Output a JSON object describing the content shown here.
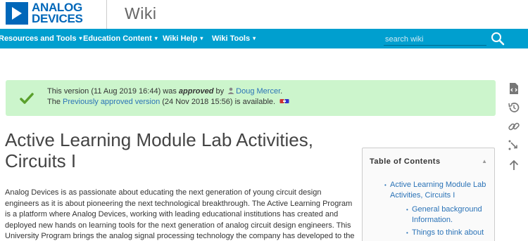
{
  "header": {
    "logo_line1": "ANALOG",
    "logo_line2": "DEVICES",
    "site_title": "Wiki"
  },
  "nav": {
    "items": [
      {
        "label": "Resources and Tools"
      },
      {
        "label": "Education Content"
      },
      {
        "label": "Wiki Help"
      },
      {
        "label": "Wiki Tools"
      }
    ],
    "search_placeholder": "search wiki"
  },
  "notice": {
    "line1_prefix": "This version (11 Aug 2019 16:44) was ",
    "line1_status": "approved",
    "line1_by": " by ",
    "line1_user": "Doug Mercer",
    "line1_end": ".",
    "line2_prefix": "The ",
    "line2_link": "Previously approved version",
    "line2_suffix": " (24 Nov 2018 15:56) is available."
  },
  "page": {
    "title": "Active Learning Module Lab Activities, Circuits I",
    "intro": "Analog Devices is as passionate about educating the next generation of young circuit design engineers as it is about pioneering the next technological breakthrough. The Active Learning Program is a platform where Analog Devices, working with leading educational institutions has created and deployed new hands on learning tools for the next generation of analog circuit design engineers. This University Program brings the analog signal processing technology the company has developed to the academic community"
  },
  "toc": {
    "title": "Table of Contents",
    "items": [
      {
        "label": "Active Learning Module Lab Activities, Circuits I"
      },
      {
        "label": "General background Information."
      },
      {
        "label": "Things to think about"
      }
    ]
  },
  "colors": {
    "brand_blue": "#0067b9",
    "nav_bar": "#009fcf",
    "notice_bg": "#ccf5cc",
    "link": "#2b73b7"
  }
}
